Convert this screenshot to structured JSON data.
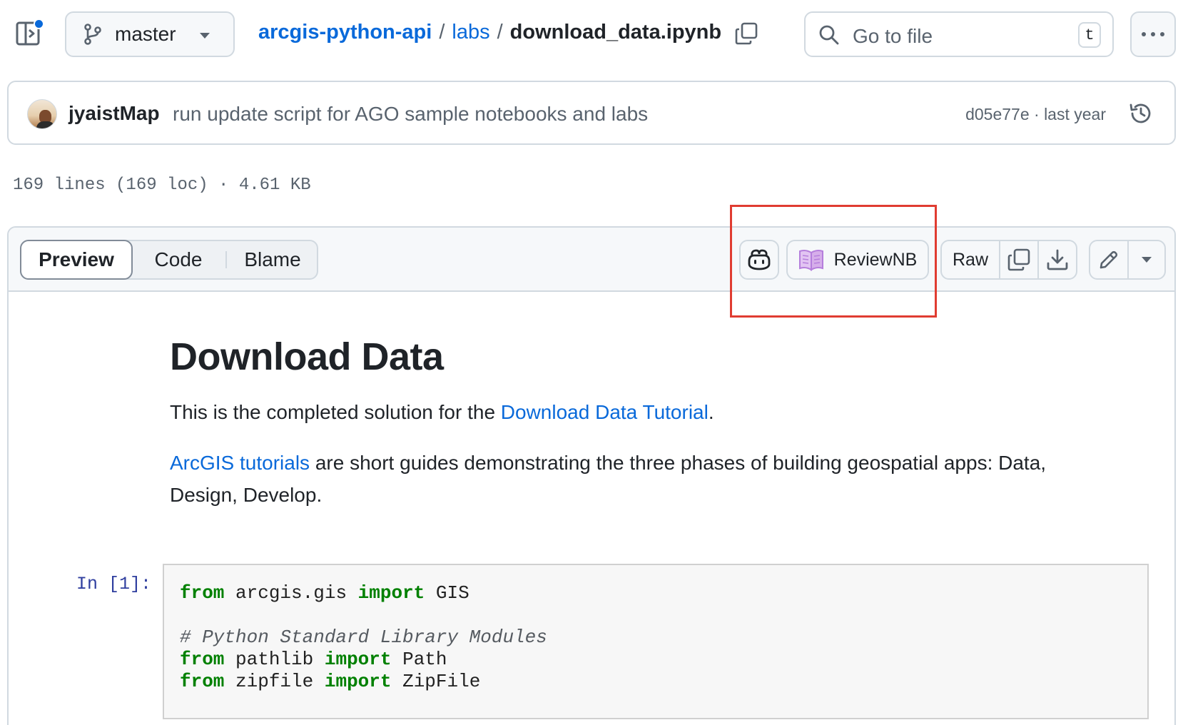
{
  "toolbar": {
    "branch": "master",
    "breadcrumb": {
      "repo": "arcgis-python-api",
      "sep1": "/",
      "folder": "labs",
      "sep2": "/",
      "file": "download_data.ipynb"
    },
    "goto_placeholder": "Go to file",
    "goto_shortcut": "t"
  },
  "commit": {
    "author": "jyaistMap",
    "message": "run update script for AGO sample notebooks and labs",
    "meta": "d05e77e · last year"
  },
  "file_info": "169 lines (169 loc) · 4.61 KB",
  "viewer": {
    "tabs": {
      "preview": "Preview",
      "code": "Code",
      "blame": "Blame"
    },
    "reviewnb_label": "ReviewNB",
    "raw_label": "Raw"
  },
  "notebook": {
    "title": "Download Data",
    "p1_text": "This is the completed solution for the ",
    "p1_link": "Download Data Tutorial",
    "p1_end": ".",
    "p2_link": "ArcGIS tutorials",
    "p2_text": " are short guides demonstrating the three phases of building geospatial apps: Data, Design, Develop.",
    "prompt": "In [1]:",
    "code": {
      "l1": {
        "kw1": "from",
        "t1": " arcgis.gis ",
        "kw2": "import",
        "t2": " GIS"
      },
      "comment": "# Python Standard Library Modules",
      "l3": {
        "kw1": "from",
        "t1": " pathlib ",
        "kw2": "import",
        "t2": " Path"
      },
      "l4": {
        "kw1": "from",
        "t1": " zipfile ",
        "kw2": "import",
        "t2": " ZipFile"
      }
    }
  },
  "colors": {
    "link": "#0969da",
    "highlight": "#e03c31",
    "keyword": "#008000",
    "reviewnb": "#b57edc"
  }
}
